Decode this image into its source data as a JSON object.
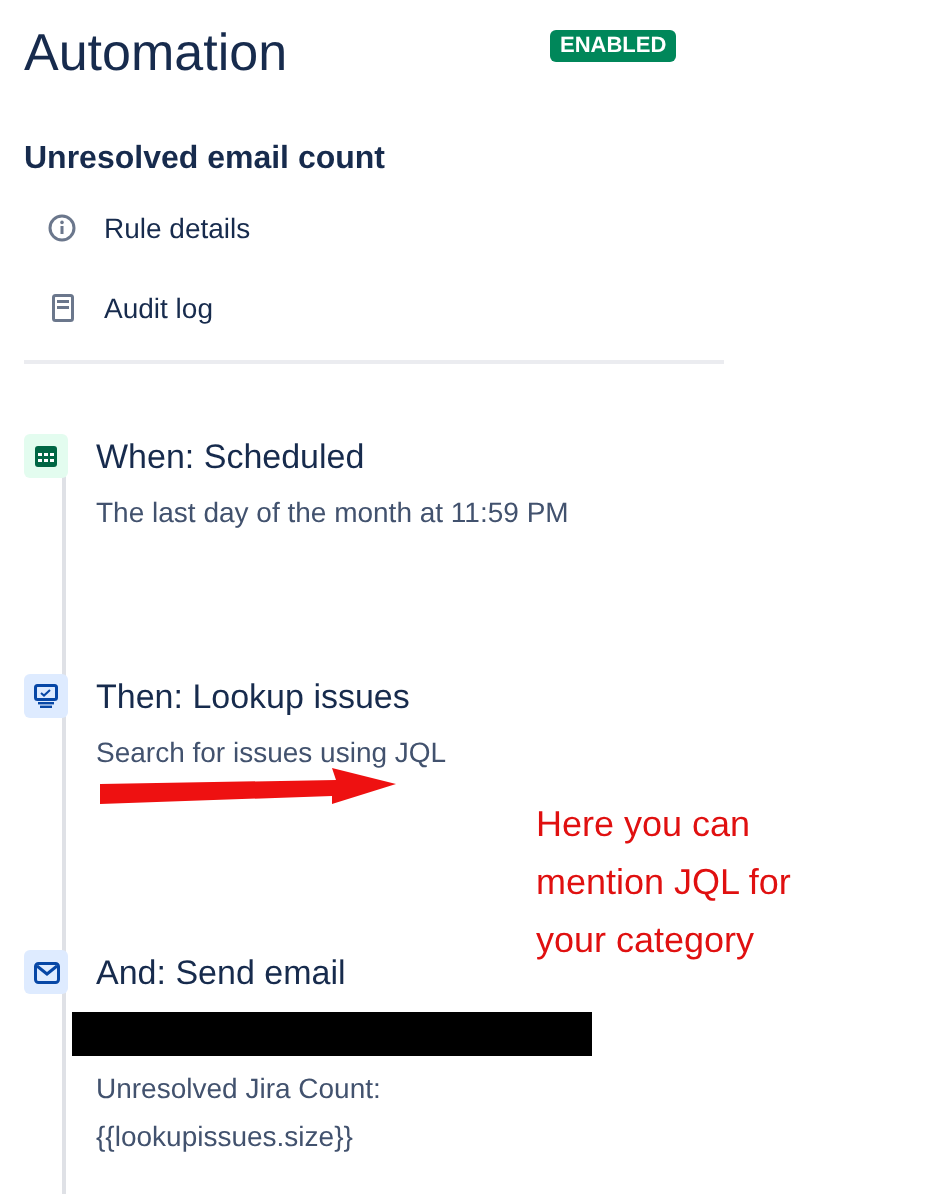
{
  "header": {
    "title": "Automation",
    "status_badge": "ENABLED"
  },
  "rule_name": "Unresolved email count",
  "menu": [
    {
      "kind": "info",
      "label": "Rule details"
    },
    {
      "kind": "log",
      "label": "Audit log"
    }
  ],
  "steps": [
    {
      "kind": "schedule",
      "title": "When: Scheduled",
      "lines": [
        {
          "kind": "text",
          "text": "The last day of the month at 11:59 PM"
        }
      ]
    },
    {
      "kind": "lookup",
      "title": "Then: Lookup issues",
      "lines": [
        {
          "kind": "text",
          "text": "Search for issues using JQL"
        },
        {
          "kind": "scribble"
        }
      ],
      "annotation": "Here you can mention JQL for your category"
    },
    {
      "kind": "email",
      "title": "And: Send email",
      "lines": [
        {
          "kind": "redacted"
        },
        {
          "kind": "text",
          "text": "Unresolved Jira Count:"
        },
        {
          "kind": "text",
          "text": "{{lookupissues.size}}"
        }
      ]
    }
  ]
}
